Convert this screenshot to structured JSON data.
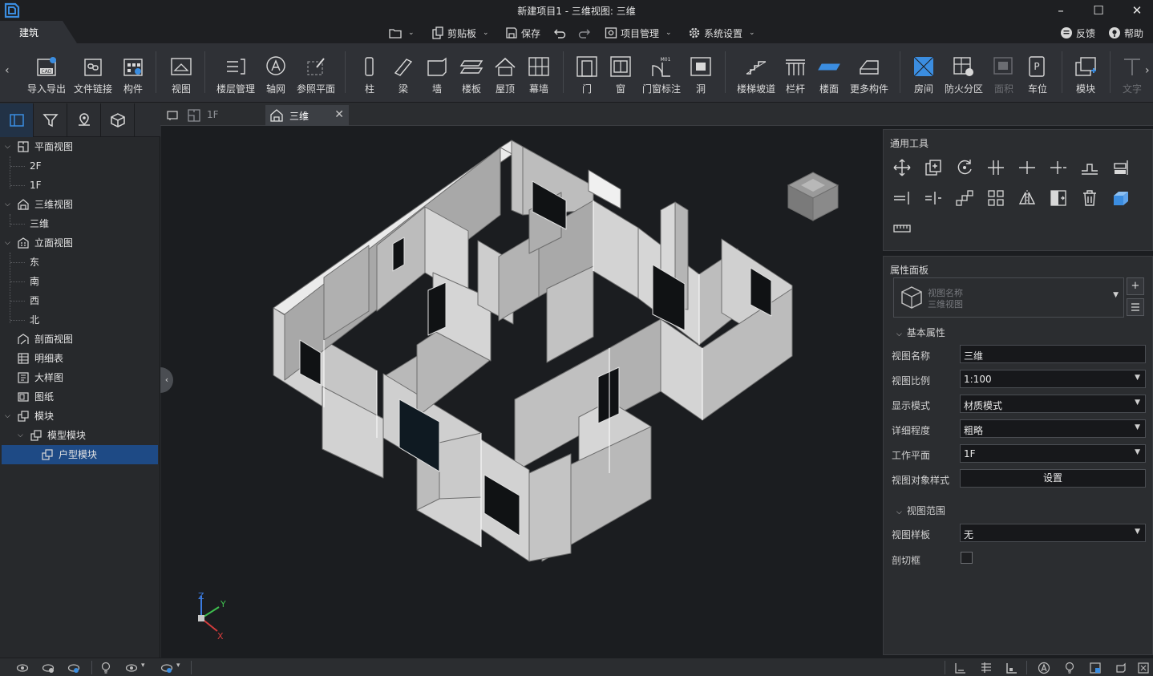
{
  "window": {
    "title": "新建项目1 - 三维视图: 三维",
    "minimize": "–",
    "maximize": "☐",
    "close": "✕"
  },
  "ribbon_tab": "建筑",
  "quick_access": {
    "clipboard": "剪贴板",
    "save": "保存",
    "project_mgmt": "项目管理",
    "system_settings": "系统设置",
    "feedback": "反馈",
    "help": "帮助"
  },
  "ribbon": {
    "import_export": "导入导出",
    "file_link": "文件链接",
    "component": "构件",
    "view": "视图",
    "floor_mgmt": "楼层管理",
    "axis_grid": "轴网",
    "ref_plane": "参照平面",
    "column": "柱",
    "beam": "梁",
    "wall": "墙",
    "slab": "楼板",
    "roof": "屋顶",
    "curtain_wall": "幕墙",
    "door": "门",
    "window": "窗",
    "door_window_tag": "门窗标注",
    "opening": "洞",
    "stair_ramp": "楼梯坡道",
    "railing": "栏杆",
    "floor_finish": "楼面",
    "more_components": "更多构件",
    "room": "房间",
    "fire_zone": "防火分区",
    "area": "面积",
    "parking": "车位",
    "module": "模块",
    "text": "文字",
    "cad_badge": "CAD",
    "door_tag_badge": "M01",
    "parking_badge": "P"
  },
  "tree": {
    "plan_views": "平面视图",
    "floor_2f": "2F",
    "floor_1f": "1F",
    "views_3d": "三维视图",
    "view_3d": "三维",
    "elevation_views": "立面视图",
    "east": "东",
    "south": "南",
    "west": "西",
    "north": "北",
    "section_views": "剖面视图",
    "schedule": "明细表",
    "detail": "大样图",
    "sheet": "图纸",
    "module": "模块",
    "model_module": "模型模块",
    "unit_module": "户型模块"
  },
  "doc_tabs": {
    "tab_1f": "1F",
    "tab_3d": "三维",
    "close": "✕"
  },
  "axes": {
    "x": "X",
    "y": "Y",
    "z": "Z"
  },
  "tools_panel": {
    "title": "通用工具"
  },
  "properties": {
    "title": "属性面板",
    "view_name_caption": "视图名称",
    "view_type_caption": "三维视图",
    "add": "+",
    "basic_section": "基本属性",
    "view_name_label": "视图名称",
    "view_name_value": "三维",
    "scale_label": "视图比例",
    "scale_value": "1:100",
    "display_mode_label": "显示模式",
    "display_mode_value": "材质模式",
    "detail_level_label": "详细程度",
    "detail_level_value": "粗略",
    "work_plane_label": "工作平面",
    "work_plane_value": "1F",
    "object_style_label": "视图对象样式",
    "object_style_button": "设置",
    "range_section": "视图范围",
    "template_label": "视图样板",
    "template_value": "无",
    "section_box_label": "剖切框",
    "section_box_checked": false
  },
  "colors": {
    "accent": "#1e4a85",
    "icon_blue": "#3b8de0",
    "wall_light": "#cfcfcf",
    "wall_top": "#e8e8e8"
  }
}
